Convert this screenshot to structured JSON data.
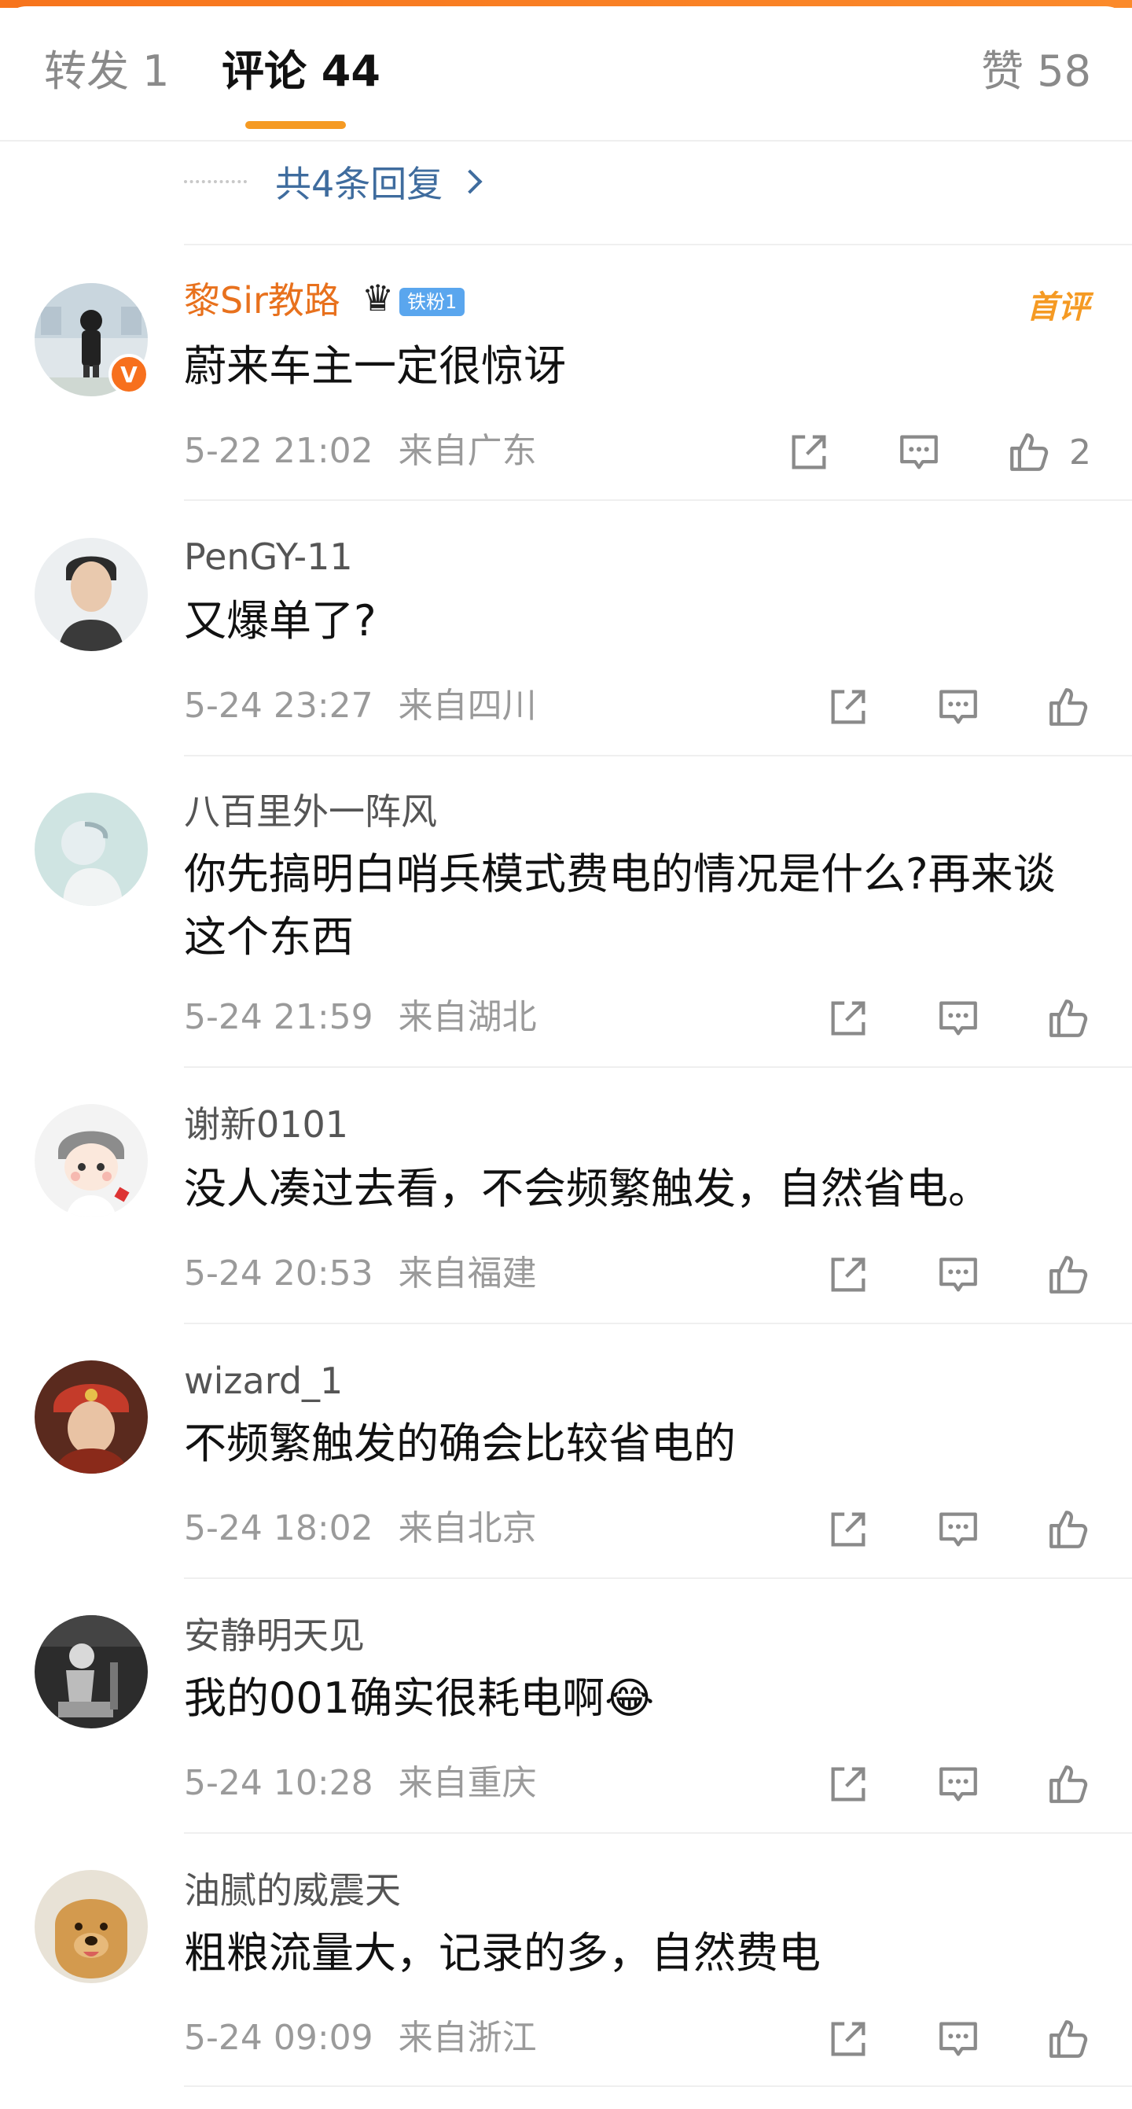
{
  "tabs": {
    "repost": "转发 1",
    "comments": "评论 44",
    "likes": "赞 58"
  },
  "replies_link": "共4条回复",
  "comments": [
    {
      "username": "黎Sir教路",
      "fan_badge": "铁粉1",
      "first_badge": "首评",
      "text": "蔚来车主一定很惊讶",
      "time": "5-22 21:02",
      "location": "来自广东",
      "likes": "2"
    },
    {
      "username": "PenGY-11",
      "text": "又爆单了?",
      "time": "5-24 23:27",
      "location": "来自四川"
    },
    {
      "username": "八百里外一阵风",
      "text": "你先搞明白哨兵模式费电的情况是什么?再来谈这个东西",
      "time": "5-24 21:59",
      "location": "来自湖北"
    },
    {
      "username": "谢新0101",
      "text": "没人凑过去看，不会频繁触发，自然省电。",
      "time": "5-24 20:53",
      "location": "来自福建"
    },
    {
      "username": "wizard_1",
      "text": "不频繁触发的确会比较省电的",
      "time": "5-24 18:02",
      "location": "来自北京"
    },
    {
      "username": "安静明天见",
      "text": "我的001确实很耗电啊😂",
      "time": "5-24 10:28",
      "location": "来自重庆"
    },
    {
      "username": "油腻的威震天",
      "text": "粗粮流量大，记录的多，自然费电",
      "time": "5-24 09:09",
      "location": "来自浙江"
    }
  ],
  "icons": {
    "share": "share-icon",
    "reply": "comment-icon",
    "like": "thumbs-up-icon",
    "verified": "verified-v-icon",
    "crown": "crown-icon",
    "arrow": "chevron-right-icon"
  },
  "colors": {
    "accent": "#f59a23",
    "link": "#3f6c9e",
    "vip_name": "#e8711d",
    "fan_badge": "#5aa6ee"
  }
}
